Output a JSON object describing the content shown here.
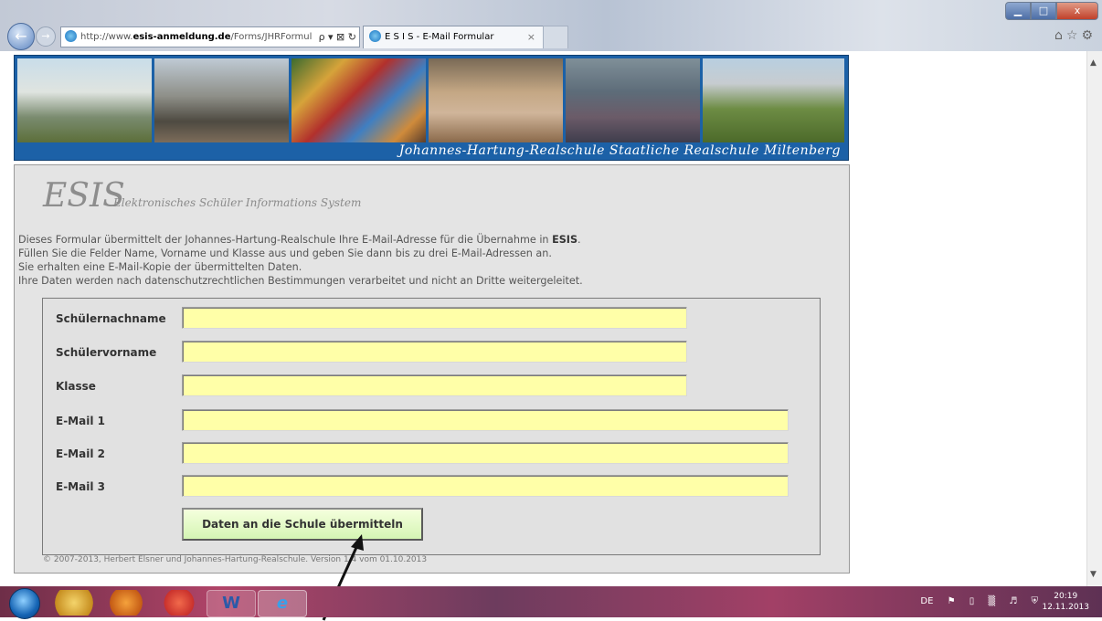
{
  "browser": {
    "address_url_prefix": "http://www.",
    "address_url_domain": "esis-anmeldung.de",
    "address_url_path": "/Forms/JHRFormul",
    "address_controls": "ρ ▾ ⊠ ↻",
    "tab_title": "E S I S - E-Mail Formular",
    "tab_close": "×",
    "window_minimize": "▁",
    "window_maximize": "□",
    "window_close": "x",
    "toolbar_icons": "⌂☆⚙"
  },
  "banner": {
    "caption": "Johannes-Hartung-Realschule Staatliche Realschule Miltenberg"
  },
  "esis": {
    "logo": "ESIS",
    "subtitle": "Elektronisches Schüler Informations System",
    "intro_line1_a": "Dieses Formular übermittelt der Johannes-Hartung-Realschule Ihre E-Mail-Adresse für die Übernahme in ",
    "intro_line1_b": "ESIS",
    "intro_line1_c": ".",
    "intro_line2": "Füllen Sie die Felder Name, Vorname und Klasse aus und geben Sie dann bis zu drei E-Mail-Adressen an.",
    "intro_line3": "Sie erhalten eine E-Mail-Kopie der übermittelten Daten.",
    "intro_line4": "Ihre Daten werden nach datenschutzrechtlichen Bestimmungen verarbeitet und nicht an Dritte weitergeleitet."
  },
  "form": {
    "fields": [
      {
        "label": "Schülernachname",
        "value": ""
      },
      {
        "label": "Schülervorname",
        "value": ""
      },
      {
        "label": "Klasse",
        "value": ""
      },
      {
        "label": "E-Mail 1",
        "value": ""
      },
      {
        "label": "E-Mail 2",
        "value": ""
      },
      {
        "label": "E-Mail 3",
        "value": ""
      }
    ],
    "submit_label": "Daten an die Schule übermitteln"
  },
  "footer": {
    "text": "© 2007-2013, Herbert Elsner und Johannes-Hartung-Realschule. Version 1.4 vom 01.10.2013"
  },
  "taskbar": {
    "word_label": "W",
    "ie_label": "e",
    "language": "DE",
    "clock_time": "20:19",
    "clock_date": "12.11.2013"
  }
}
